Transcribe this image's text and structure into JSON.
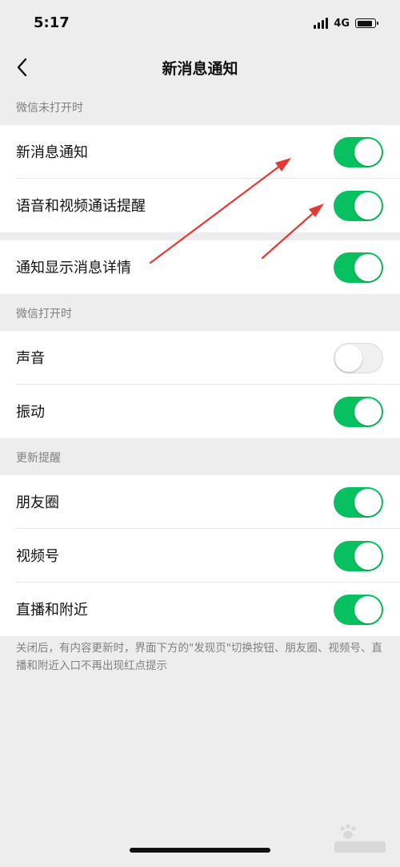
{
  "status_bar": {
    "time": "5:17",
    "network": "4G",
    "battery_level_pct": 90
  },
  "nav": {
    "title": "新消息通知",
    "back_icon": "chevron-left-icon"
  },
  "sections": [
    {
      "header": "微信未打开时"
    },
    {
      "header": "微信打开时"
    },
    {
      "header": "更新提醒"
    }
  ],
  "rows": [
    {
      "label": "新消息通知",
      "on": true
    },
    {
      "label": "语音和视频通话提醒",
      "on": true
    },
    {
      "label": "通知显示消息详情",
      "on": true
    },
    {
      "label": "声音",
      "on": false
    },
    {
      "label": "振动",
      "on": true
    },
    {
      "label": "朋友圈",
      "on": true
    },
    {
      "label": "视频号",
      "on": true
    },
    {
      "label": "直播和附近",
      "on": true
    }
  ],
  "footnote": "关闭后，有内容更新时，界面下方的\"发现页\"切换按钮、朋友圈、视频号、直播和附近入口不再出现红点提示",
  "colors": {
    "toggle_on": "#07c160",
    "toggle_off": "#f0f0f0",
    "background": "#ededed",
    "annotation_arrow": "#e53935"
  },
  "watermark_icon": "baidu-jingyan-watermark-icon"
}
